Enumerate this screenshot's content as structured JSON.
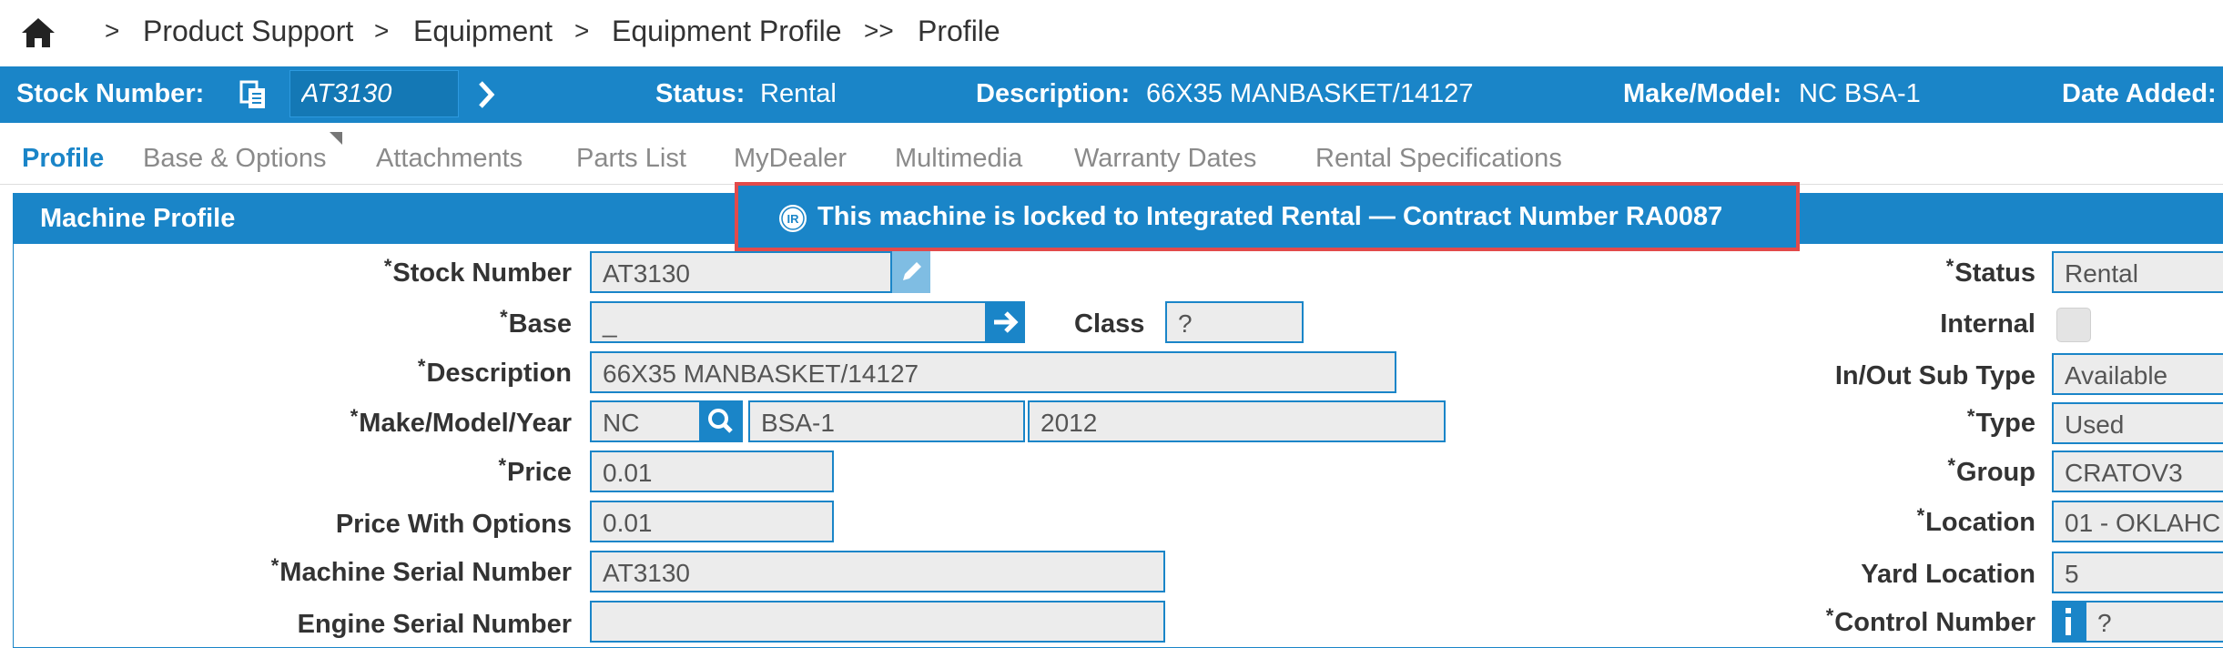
{
  "breadcrumb": {
    "items": [
      "Product Support",
      "Equipment",
      "Equipment Profile",
      "Profile"
    ],
    "separators": [
      ">",
      ">",
      ">",
      ">>"
    ]
  },
  "stock_bar": {
    "stock_number_label": "Stock Number:",
    "stock_number_value": "AT3130",
    "status_label": "Status:",
    "status_value": "Rental",
    "description_label": "Description:",
    "description_value": "66X35 MANBASKET/14127",
    "make_model_label": "Make/Model:",
    "make_model_value": "NC BSA-1",
    "date_added_label": "Date Added:"
  },
  "tabs": [
    {
      "label": "Profile",
      "active": true
    },
    {
      "label": "Base & Options",
      "active": false
    },
    {
      "label": "Attachments",
      "active": false
    },
    {
      "label": "Parts List",
      "active": false
    },
    {
      "label": "MyDealer",
      "active": false
    },
    {
      "label": "Multimedia",
      "active": false
    },
    {
      "label": "Warranty Dates",
      "active": false
    },
    {
      "label": "Rental Specifications",
      "active": false
    }
  ],
  "panel": {
    "title": "Machine Profile",
    "lock_message": "This machine is locked to Integrated Rental — Contract Number RA0087",
    "lock_icon_text": "IR"
  },
  "form_left": {
    "stock_number": {
      "label": "Stock Number",
      "required": "*",
      "value": "AT3130"
    },
    "base": {
      "label": "Base",
      "required": "*",
      "value": "_"
    },
    "class": {
      "label": "Class",
      "value": "?"
    },
    "description": {
      "label": "Description",
      "required": "*",
      "value": "66X35 MANBASKET/14127"
    },
    "make_model_year": {
      "label": "Make/Model/Year",
      "required": "*",
      "make": "NC",
      "model": "BSA-1",
      "year": "2012"
    },
    "price": {
      "label": "Price",
      "required": "*",
      "value": "0.01"
    },
    "price_with_options": {
      "label": "Price With Options",
      "value": "0.01"
    },
    "machine_serial_number": {
      "label": "Machine Serial Number",
      "required": "*",
      "value": "AT3130"
    },
    "engine_serial_number": {
      "label": "Engine Serial Number",
      "value": ""
    }
  },
  "form_right": {
    "status": {
      "label": "Status",
      "required": "*",
      "value": "Rental"
    },
    "internal": {
      "label": "Internal",
      "checked": false
    },
    "in_out_sub_type": {
      "label": "In/Out Sub Type",
      "value": "Available"
    },
    "type": {
      "label": "Type",
      "required": "*",
      "value": "Used"
    },
    "group": {
      "label": "Group",
      "required": "*",
      "value": "CRATOV3"
    },
    "location": {
      "label": "Location",
      "required": "*",
      "value": "01 - OKLAHC"
    },
    "yard_location": {
      "label": "Yard Location",
      "value": "5"
    },
    "control_number": {
      "label": "Control Number",
      "required": "*",
      "value": "?"
    }
  },
  "colors": {
    "accent": "#1a85c8",
    "highlight_border": "#e24a4a",
    "field_bg": "#ececec"
  }
}
